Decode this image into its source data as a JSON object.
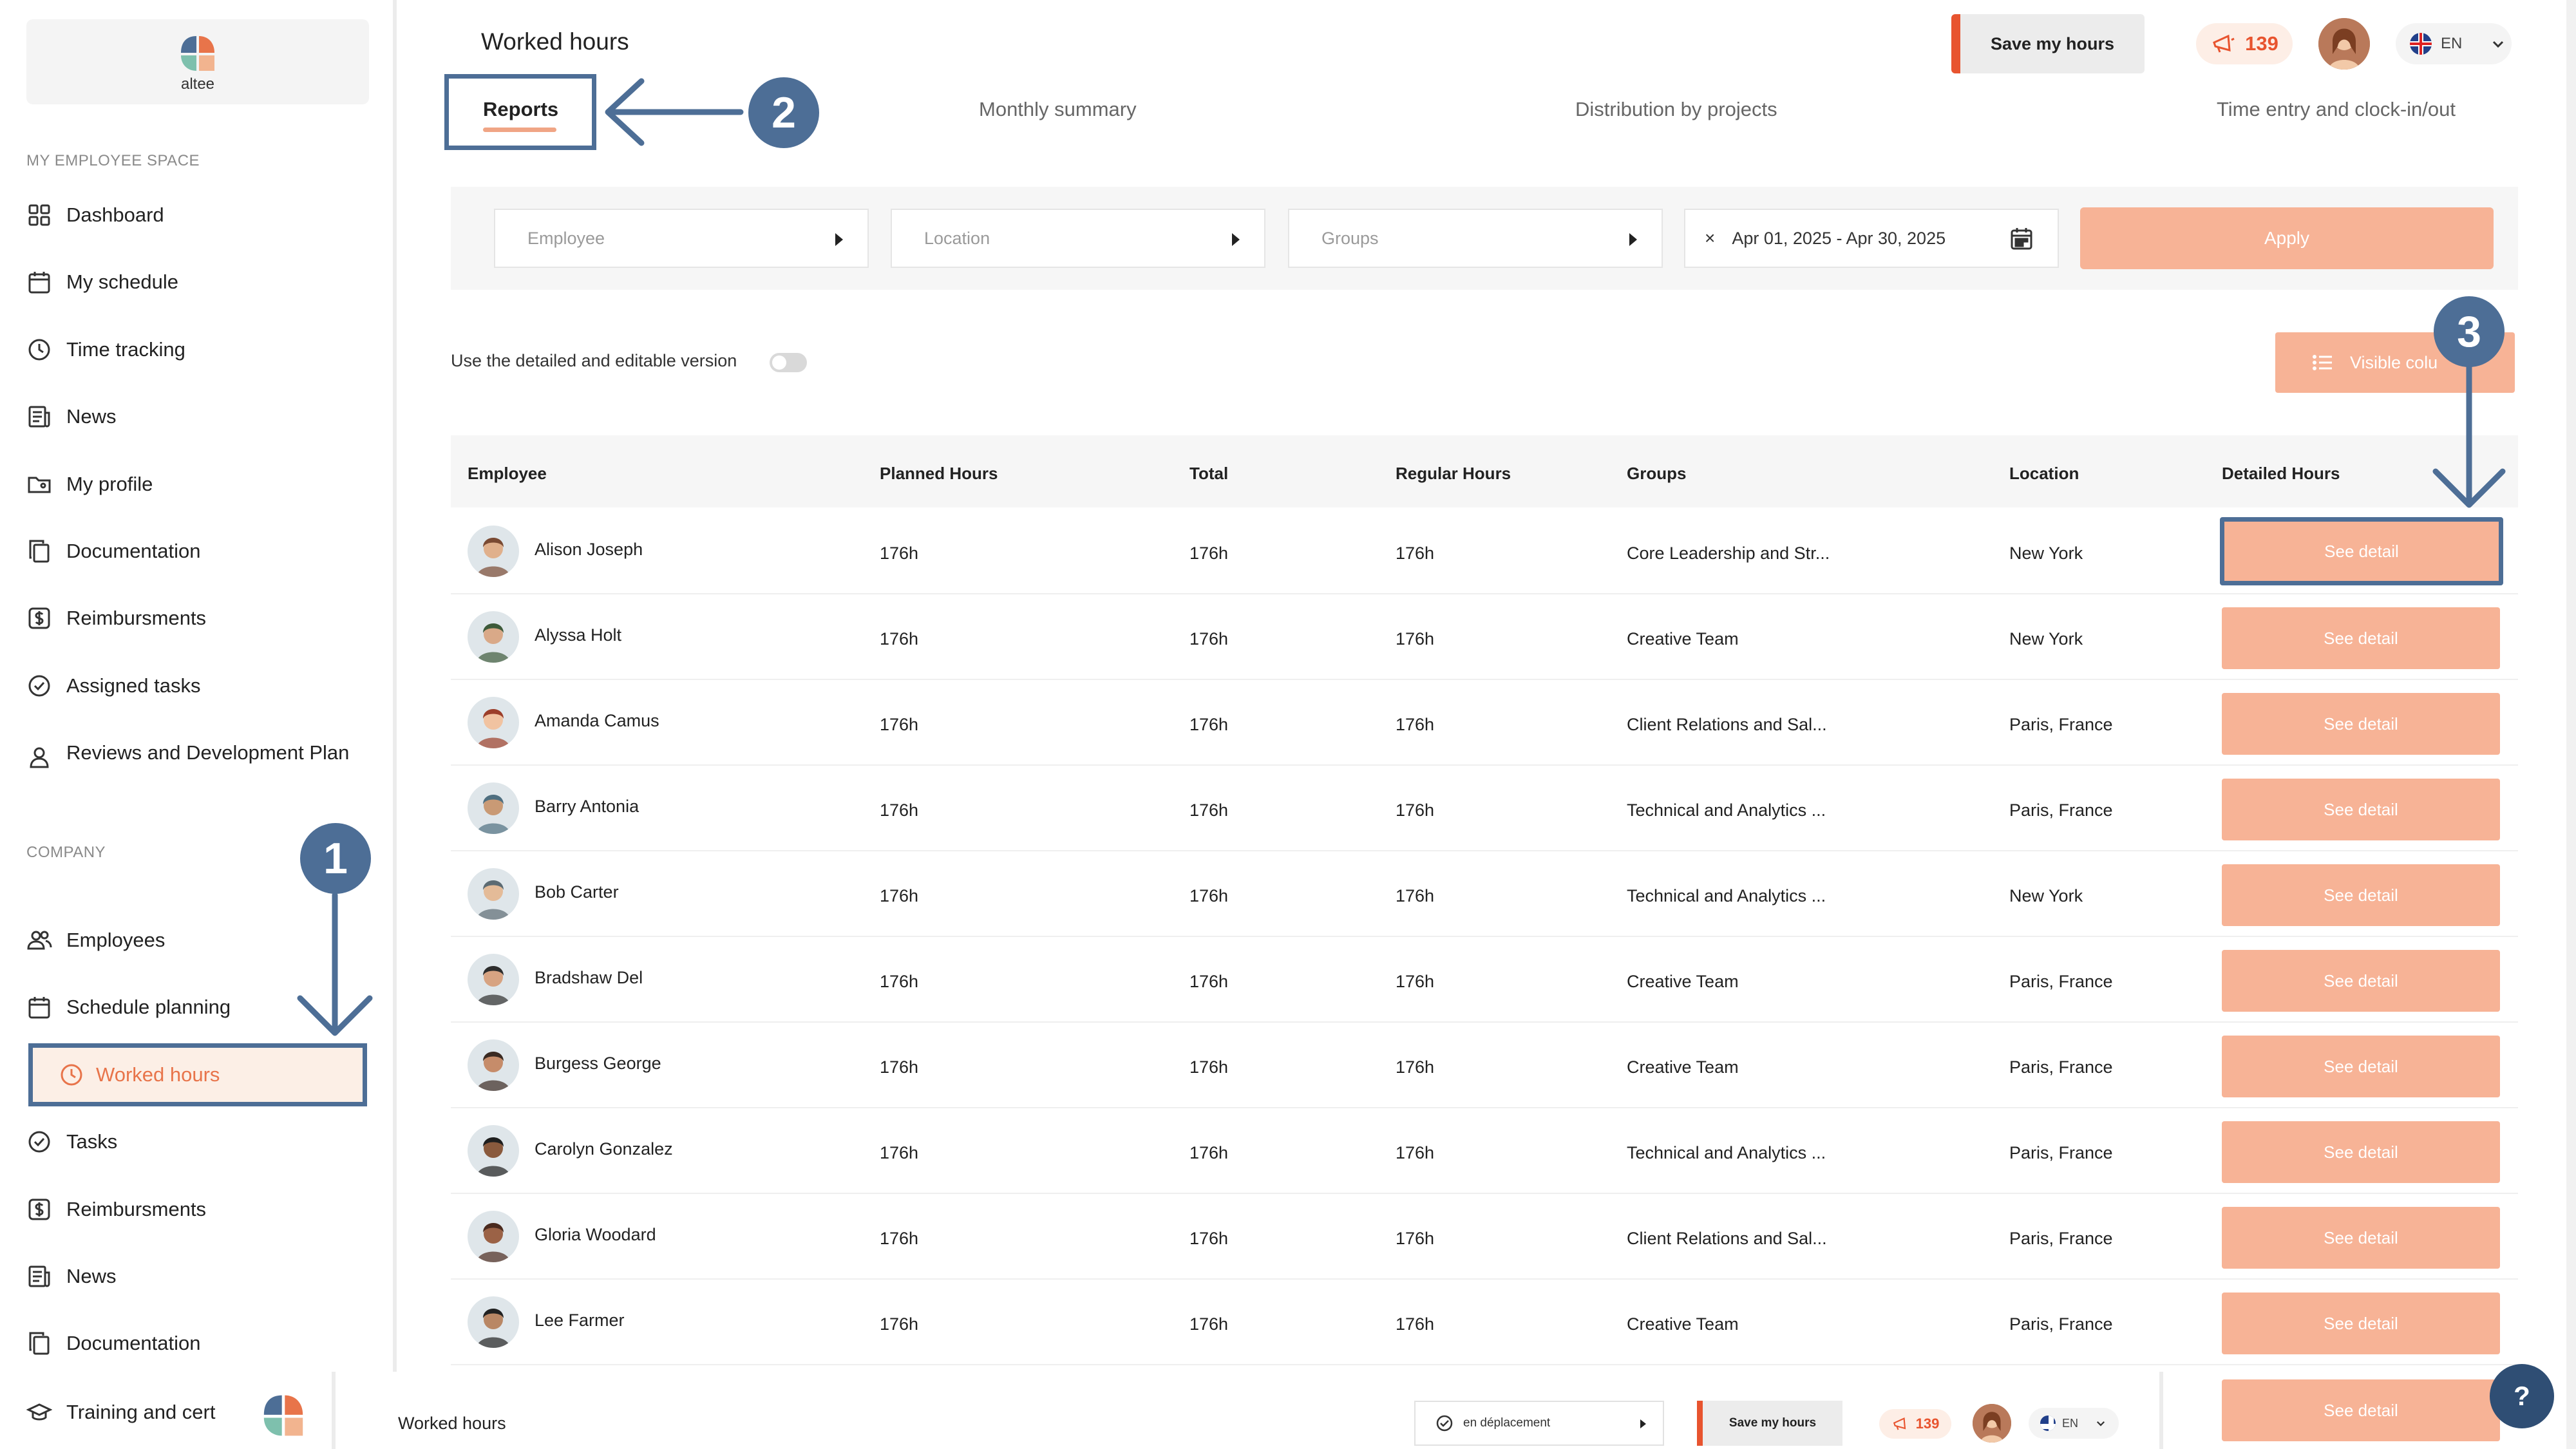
{
  "app": {
    "logo_text": "altee"
  },
  "sidebar": {
    "employee_section_label": "MY EMPLOYEE SPACE",
    "company_section_label": "COMPANY",
    "employee_items": [
      {
        "label": "Dashboard",
        "icon": "grid-icon"
      },
      {
        "label": "My schedule",
        "icon": "calendar-icon"
      },
      {
        "label": "Time tracking",
        "icon": "clock-icon"
      },
      {
        "label": "News",
        "icon": "newspaper-icon"
      },
      {
        "label": "My profile",
        "icon": "profile-folder-icon"
      },
      {
        "label": "Documentation",
        "icon": "documents-icon"
      },
      {
        "label": "Reimbursments",
        "icon": "dollar-icon"
      },
      {
        "label": "Assigned tasks",
        "icon": "check-circle-icon"
      },
      {
        "label": "Reviews and Development Plan",
        "icon": "user-icon"
      }
    ],
    "company_items": [
      {
        "label": "Employees",
        "icon": "users-icon"
      },
      {
        "label": "Schedule planning",
        "icon": "calendar-icon"
      },
      {
        "label": "Worked hours",
        "icon": "clock-icon",
        "active": true
      },
      {
        "label": "Tasks",
        "icon": "check-circle-icon"
      },
      {
        "label": "Reimbursments",
        "icon": "dollar-icon"
      },
      {
        "label": "News",
        "icon": "newspaper-icon"
      },
      {
        "label": "Documentation",
        "icon": "documents-icon"
      },
      {
        "label": "Training and cert",
        "icon": "graduation-cap-icon"
      }
    ]
  },
  "header": {
    "title": "Worked hours",
    "save_label": "Save my hours",
    "notification_count": "139",
    "language": "EN"
  },
  "tabs": [
    {
      "label": "Reports",
      "active": true
    },
    {
      "label": "Monthly summary"
    },
    {
      "label": "Distribution by projects"
    },
    {
      "label": "Time entry and clock-in/out"
    }
  ],
  "filters": {
    "employee_placeholder": "Employee",
    "location_placeholder": "Location",
    "groups_placeholder": "Groups",
    "date_range": "Apr 01, 2025 - Apr 30, 2025",
    "clear_symbol": "×",
    "apply_label": "Apply"
  },
  "toggle_label": "Use the detailed and editable version",
  "visible_columns_label": "Visible colu",
  "table": {
    "columns": [
      "Employee",
      "Planned Hours",
      "Total",
      "Regular Hours",
      "Groups",
      "Location",
      "Detailed Hours"
    ],
    "detail_label": "See detail",
    "rows": [
      {
        "name": "Alison Joseph",
        "planned": "176h",
        "total": "176h",
        "regular": "176h",
        "group": "Core Leadership and Str...",
        "location": "New York"
      },
      {
        "name": "Alyssa Holt",
        "planned": "176h",
        "total": "176h",
        "regular": "176h",
        "group": "Creative Team",
        "location": "New York"
      },
      {
        "name": "Amanda Camus",
        "planned": "176h",
        "total": "176h",
        "regular": "176h",
        "group": "Client Relations and Sal...",
        "location": "Paris, France"
      },
      {
        "name": "Barry Antonia",
        "planned": "176h",
        "total": "176h",
        "regular": "176h",
        "group": "Technical and Analytics ...",
        "location": "Paris, France"
      },
      {
        "name": "Bob Carter",
        "planned": "176h",
        "total": "176h",
        "regular": "176h",
        "group": "Technical and Analytics ...",
        "location": "New York"
      },
      {
        "name": "Bradshaw Del",
        "planned": "176h",
        "total": "176h",
        "regular": "176h",
        "group": "Creative Team",
        "location": "Paris, France"
      },
      {
        "name": "Burgess George",
        "planned": "176h",
        "total": "176h",
        "regular": "176h",
        "group": "Creative Team",
        "location": "Paris, France"
      },
      {
        "name": "Carolyn Gonzalez",
        "planned": "176h",
        "total": "176h",
        "regular": "176h",
        "group": "Technical and Analytics ...",
        "location": "Paris, France"
      },
      {
        "name": "Gloria Woodard",
        "planned": "176h",
        "total": "176h",
        "regular": "176h",
        "group": "Client Relations and Sal...",
        "location": "Paris, France"
      },
      {
        "name": "Lee Farmer",
        "planned": "176h",
        "total": "176h",
        "regular": "176h",
        "group": "Creative Team",
        "location": "Paris, France"
      }
    ]
  },
  "mini_window": {
    "title": "Worked hours",
    "status_select": "en déplacement",
    "save_label": "Save my hours",
    "notification_count": "139",
    "language": "EN",
    "detail_label": "See detail"
  },
  "help_label": "?",
  "callouts": [
    "1",
    "2",
    "3"
  ],
  "colors": {
    "accent": "#f7b396",
    "accent_strong": "#e8542f",
    "callout": "#4d6e96"
  }
}
